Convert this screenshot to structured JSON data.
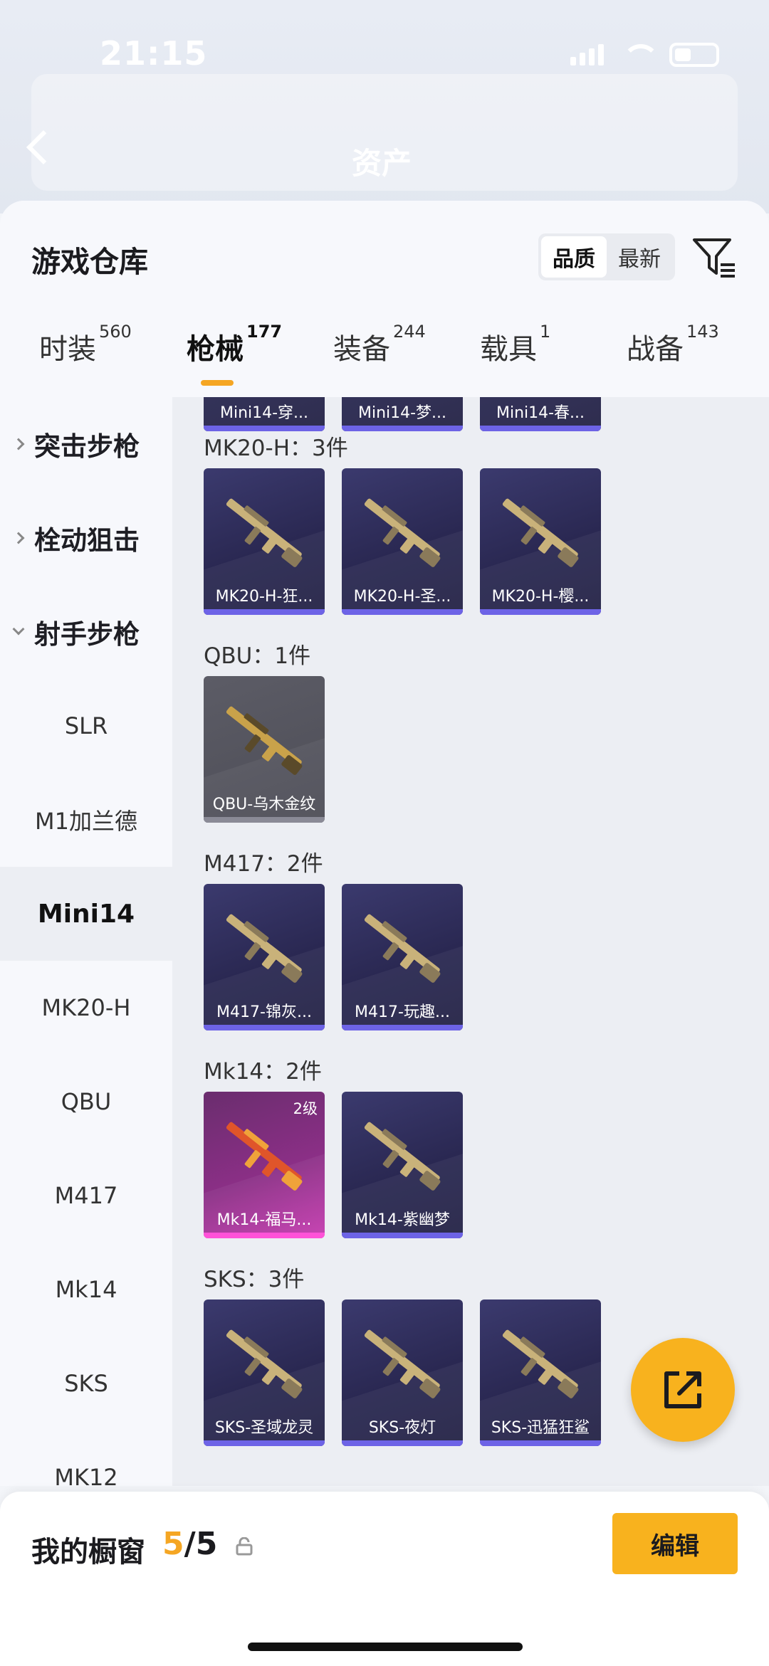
{
  "status_bar": {
    "time": "21:15"
  },
  "background_page": {
    "title": "资产"
  },
  "sheet": {
    "title": "游戏仓库",
    "sort_options": [
      {
        "label": "品质",
        "active": true
      },
      {
        "label": "最新",
        "active": false
      }
    ],
    "tabs": [
      {
        "label": "时装",
        "count": "560",
        "active": false
      },
      {
        "label": "枪械",
        "count": "177",
        "active": true
      },
      {
        "label": "装备",
        "count": "244",
        "active": false
      },
      {
        "label": "载具",
        "count": "1",
        "active": false
      },
      {
        "label": "战备",
        "count": "143",
        "active": false
      }
    ],
    "accent_color": "#f5a623"
  },
  "sidebar": {
    "items": [
      {
        "label": "突击步枪",
        "type": "group",
        "expanded": false
      },
      {
        "label": "栓动狙击",
        "type": "group",
        "expanded": false
      },
      {
        "label": "射手步枪",
        "type": "group",
        "expanded": true
      },
      {
        "label": "SLR",
        "type": "item"
      },
      {
        "label": "M1加兰德",
        "type": "item"
      },
      {
        "label": "Mini14",
        "type": "item",
        "active": true
      },
      {
        "label": "MK20-H",
        "type": "item"
      },
      {
        "label": "QBU",
        "type": "item"
      },
      {
        "label": "M417",
        "type": "item"
      },
      {
        "label": "Mk14",
        "type": "item"
      },
      {
        "label": "SKS",
        "type": "item"
      },
      {
        "label": "MK12",
        "type": "item"
      }
    ]
  },
  "content": {
    "partial_row": [
      "Mini14-穿...",
      "Mini14-梦...",
      "Mini14-春..."
    ],
    "sections": [
      {
        "title": "MK20-H：3件",
        "items": [
          {
            "name": "MK20-H-狂...",
            "style": "purple"
          },
          {
            "name": "MK20-H-圣...",
            "style": "purple"
          },
          {
            "name": "MK20-H-樱...",
            "style": "purple"
          }
        ]
      },
      {
        "title": "QBU：1件",
        "items": [
          {
            "name": "QBU-乌木金纹",
            "style": "grey"
          }
        ]
      },
      {
        "title": "M417：2件",
        "items": [
          {
            "name": "M417-锦灰...",
            "style": "purple"
          },
          {
            "name": "M417-玩趣...",
            "style": "purple"
          }
        ]
      },
      {
        "title": "Mk14：2件",
        "items": [
          {
            "name": "Mk14-福马...",
            "style": "pink",
            "level": "2级"
          },
          {
            "name": "Mk14-紫幽梦",
            "style": "purple"
          }
        ]
      },
      {
        "title": "SKS：3件",
        "items": [
          {
            "name": "SKS-圣域龙灵",
            "style": "purple"
          },
          {
            "name": "SKS-夜灯",
            "style": "purple"
          },
          {
            "name": "SKS-迅猛狂鲨",
            "style": "purple"
          }
        ]
      }
    ]
  },
  "bottom_bar": {
    "label": "我的橱窗",
    "current": "5",
    "total": "/5",
    "edit_label": "编辑"
  }
}
